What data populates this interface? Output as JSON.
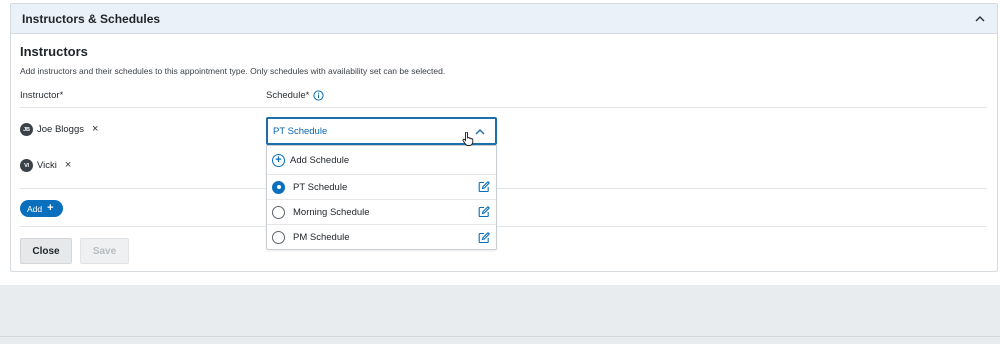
{
  "panel": {
    "title": "Instructors & Schedules"
  },
  "section": {
    "title": "Instructors",
    "description": "Add instructors and their schedules to this appointment type. Only schedules with availability set can be selected."
  },
  "columns": {
    "instructor": "Instructor*",
    "schedule": "Schedule*"
  },
  "instructors": [
    {
      "initials": "JB",
      "name": "Joe Bloggs",
      "remove": "×"
    },
    {
      "initials": "VI",
      "name": "Vicki",
      "remove": "×"
    }
  ],
  "add_button": {
    "label": "Add",
    "icon": "+"
  },
  "actions": {
    "close": "Close",
    "save": "Save"
  },
  "schedule_select": {
    "value": "PT Schedule",
    "options_header": "Add Schedule",
    "options": [
      {
        "label": "PT Schedule",
        "selected": true
      },
      {
        "label": "Morning Schedule",
        "selected": false
      },
      {
        "label": "PM Schedule",
        "selected": false
      }
    ]
  },
  "colors": {
    "accent": "#0a6fbd",
    "header_bg": "#eaf1f8",
    "select_border": "#1c6fa8"
  }
}
